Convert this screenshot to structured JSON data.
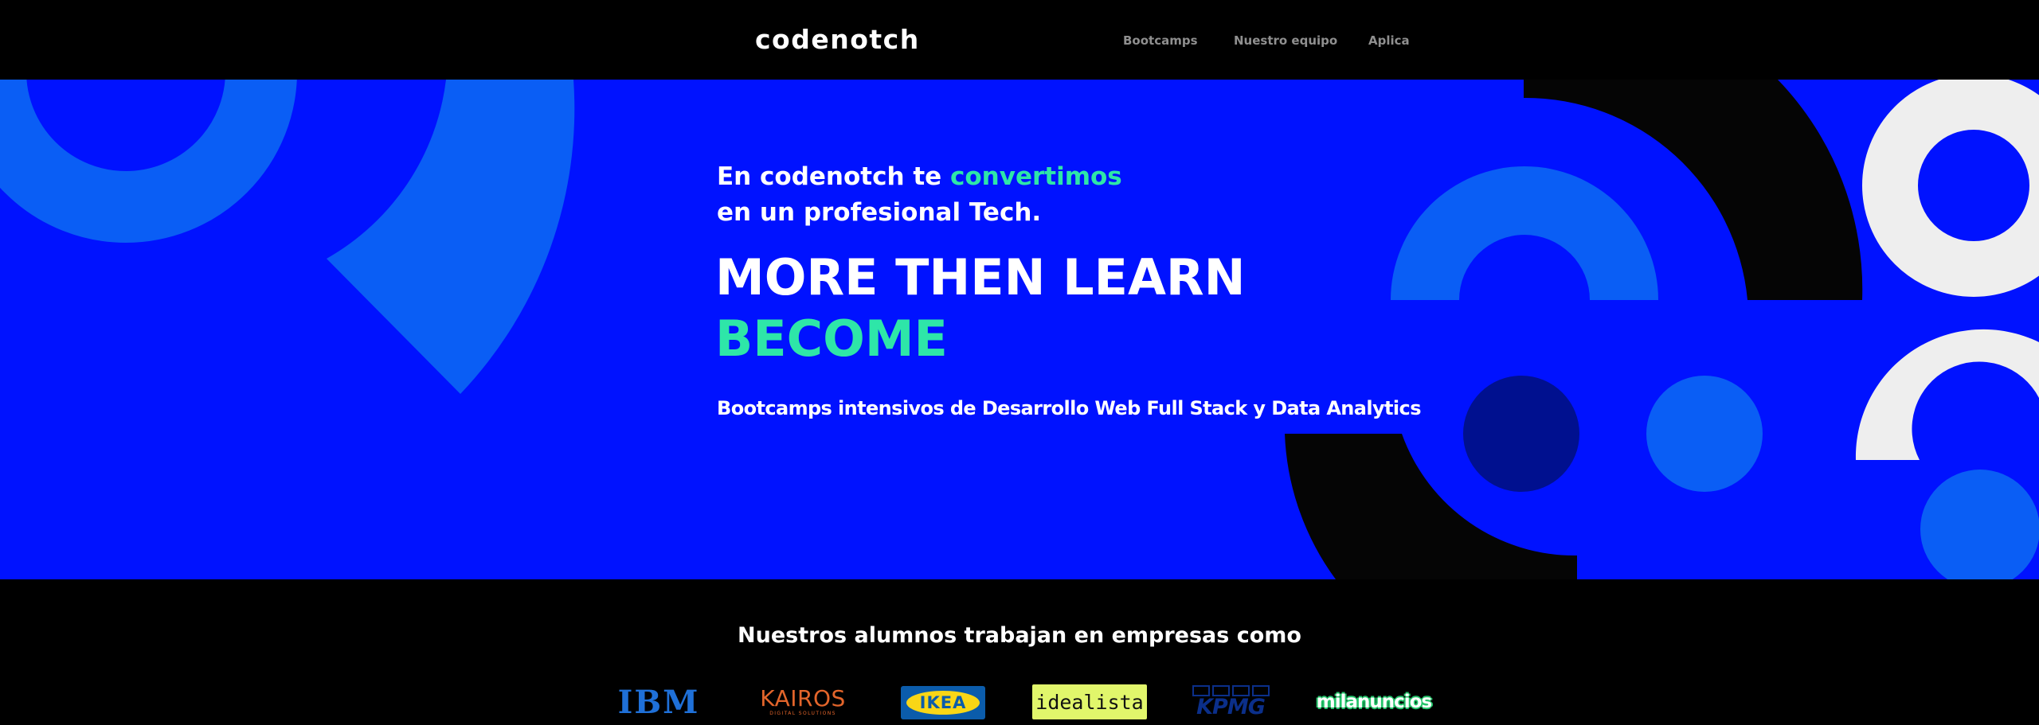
{
  "nav": {
    "logo": "codenotch",
    "links": [
      "Bootcamps",
      "Nuestro equipo",
      "Aplica"
    ]
  },
  "hero": {
    "intro_prefix": "En codenotch te ",
    "intro_accent": "convertimos",
    "intro_line2": "en un profesional Tech.",
    "headline_line1": "MORE THEN LEARN",
    "headline_line2": "BECOME",
    "subline": "Bootcamps intensivos de Desarrollo Web Full Stack y Data Analytics"
  },
  "companies": {
    "title": "Nuestros alumnos trabajan en empresas como",
    "logos": {
      "ibm": "IBM",
      "kairos": "KAIROS",
      "kairos_sub": "DIGITAL SOLUTIONS",
      "ikea": "IKEA",
      "idealista": "idealista",
      "kpmg": "KPMG",
      "milanuncios": "milanuncios"
    }
  },
  "colors": {
    "hero_bg": "#0012ff",
    "accent": "#2ee6a8",
    "nav_link": "#8f8f8f",
    "light_blue_shape": "#0a5ef5",
    "dark_navy_shape": "#00108f",
    "black_shape": "#050505",
    "white_shape": "#eeeeee"
  }
}
